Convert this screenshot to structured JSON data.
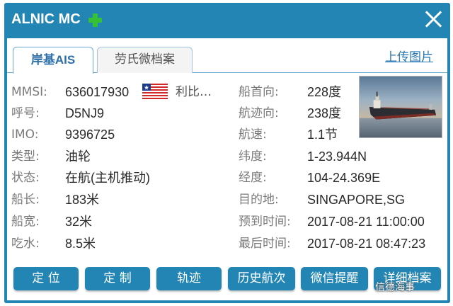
{
  "window": {
    "title": "ALNIC MC"
  },
  "tabs": [
    {
      "label_prefix": "岸基",
      "label_suffix": "AIS"
    },
    {
      "label": "劳氏微档案"
    }
  ],
  "upload_link": "上传图片",
  "left_fields": [
    {
      "label": "MMSI:",
      "value": "636017930"
    },
    {
      "label": "呼号:",
      "value": "D5NJ9"
    },
    {
      "label": "IMO:",
      "value": "9396725"
    },
    {
      "label": "类型:",
      "value": "油轮"
    },
    {
      "label": "状态:",
      "value": "在航(主机推动)"
    },
    {
      "label": "船长:",
      "value": "183米"
    },
    {
      "label": "船宽:",
      "value": "32米"
    },
    {
      "label": "吃水:",
      "value": "8.5米"
    }
  ],
  "flag_country": "利比…",
  "right_fields": [
    {
      "label": "船首向:",
      "value": "228度"
    },
    {
      "label": "航迹向:",
      "value": "238度"
    },
    {
      "label": "航速:",
      "value": "1.1节"
    },
    {
      "label": "纬度:",
      "value": "1-23.944N"
    },
    {
      "label": "经度:",
      "value": "104-24.369E"
    },
    {
      "label": "目的地:",
      "value": "SINGAPORE,SG"
    },
    {
      "label": "预到时间:",
      "value": "2017-08-21 11:00:00"
    },
    {
      "label": "最后时间:",
      "value": "2017-08-21 08:47:23"
    }
  ],
  "buttons": [
    "定 位",
    "定 制",
    "轨迹",
    "历史航次",
    "微信提醒",
    "详细档案"
  ],
  "watermark": "信德海事",
  "colors": {
    "header_blue": "#2385b4",
    "plus_green": "#34c234",
    "link_blue": "#2477b4"
  }
}
